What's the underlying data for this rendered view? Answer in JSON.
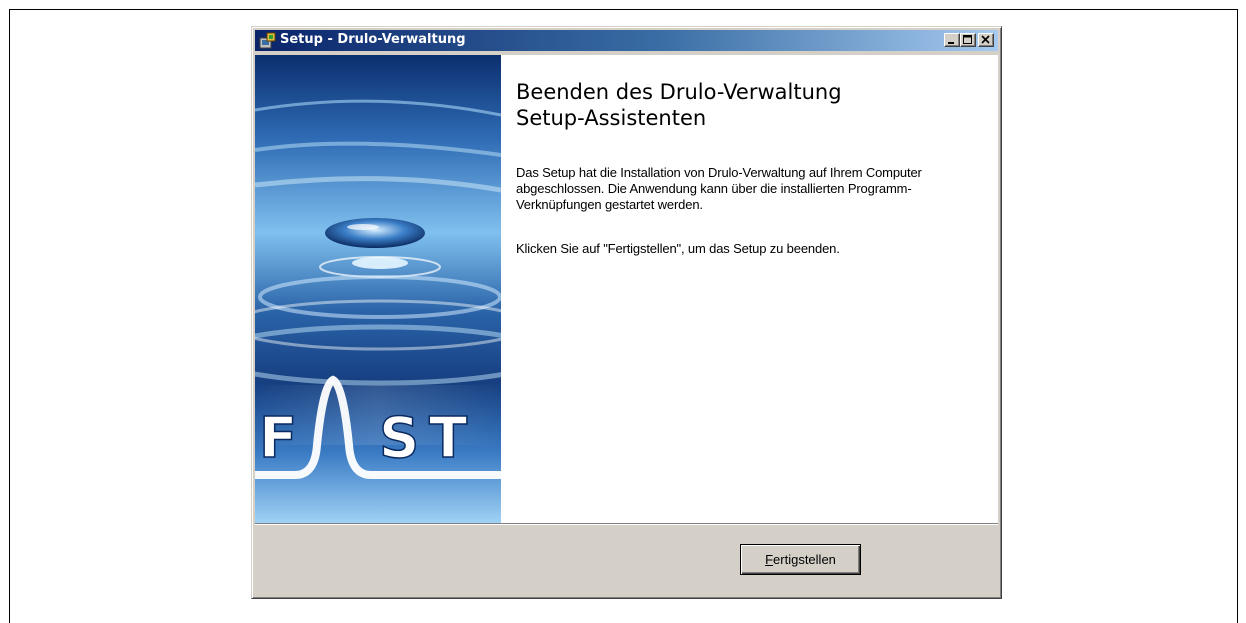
{
  "window": {
    "title": "Setup - Drulo-Verwaltung"
  },
  "titlebar_buttons": {
    "minimize": "minimize-icon",
    "maximize": "maximize-icon",
    "close": "close-icon"
  },
  "banner": {
    "logo_text": "FAST",
    "colors": {
      "water_dark": "#0b2f6e",
      "water_mid": "#2f6cb5",
      "water_light": "#9fd2f5"
    }
  },
  "main": {
    "heading_line1": "Beenden des Drulo-Verwaltung",
    "heading_line2": "Setup-Assistenten",
    "paragraph1": "Das Setup hat die Installation von Drulo-Verwaltung auf Ihrem Computer abgeschlossen. Die Anwendung kann über die installierten Programm-Verknüpfungen gestartet werden.",
    "paragraph2": "Klicken Sie auf \"Fertigstellen\", um das Setup zu beenden."
  },
  "footer": {
    "finish_hotkey": "F",
    "finish_rest": "ertigstellen"
  }
}
